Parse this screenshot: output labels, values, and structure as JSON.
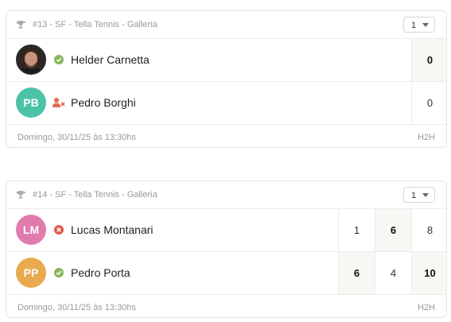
{
  "matches": [
    {
      "header": "#13 - SF - Tella Tennis - Galleria",
      "select_value": "1",
      "players": [
        {
          "name": "Helder Carnetta",
          "initials": "",
          "avatar_color": "#3a2e2a",
          "status": "confirmed",
          "scores": [
            "0"
          ]
        },
        {
          "name": "Pedro Borghi",
          "initials": "PB",
          "avatar_color": "#4cc3a6",
          "status": "removed",
          "scores": [
            "0"
          ]
        }
      ],
      "footer_date": "Domingo, 30/11/25 às 13:30hs",
      "h2h": "H2H"
    },
    {
      "header": "#14 - SF - Tella Tennis - Galleria",
      "select_value": "1",
      "players": [
        {
          "name": "Lucas Montanari",
          "initials": "LM",
          "avatar_color": "#e07bad",
          "status": "lost",
          "scores": [
            "1",
            "6",
            "8"
          ]
        },
        {
          "name": "Pedro Porta",
          "initials": "PP",
          "avatar_color": "#e9a94e",
          "status": "confirmed",
          "scores": [
            "6",
            "4",
            "10"
          ]
        }
      ],
      "footer_date": "Domingo, 30/11/25 às 13:30hs",
      "h2h": "H2H"
    }
  ],
  "colors": {
    "check": "#8ab55a",
    "removed": "#e76a55",
    "lost": "#e05a4a"
  }
}
